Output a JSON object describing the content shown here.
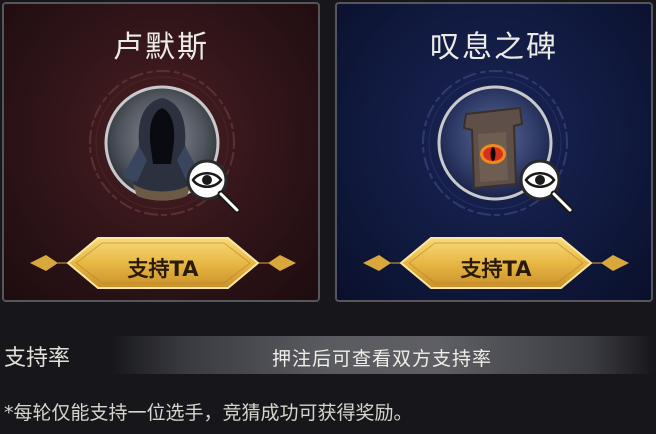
{
  "left_card": {
    "name": "卢默斯",
    "support_label": "支持TA",
    "portrait_icon": "hooded-figure-icon",
    "inspect_icon": "eye-magnifier-icon"
  },
  "right_card": {
    "name": "叹息之碑",
    "support_label": "支持TA",
    "portrait_icon": "eye-monument-icon",
    "inspect_icon": "eye-magnifier-icon"
  },
  "support_rate": {
    "label": "支持率",
    "hint": "押注后可查看双方支持率"
  },
  "footnote": "*每轮仅能支持一位选手，竞猜成功可获得奖励。",
  "colors": {
    "left_card_bg": "#2f1418",
    "right_card_bg": "#111a40",
    "gold": "#e8b844"
  }
}
